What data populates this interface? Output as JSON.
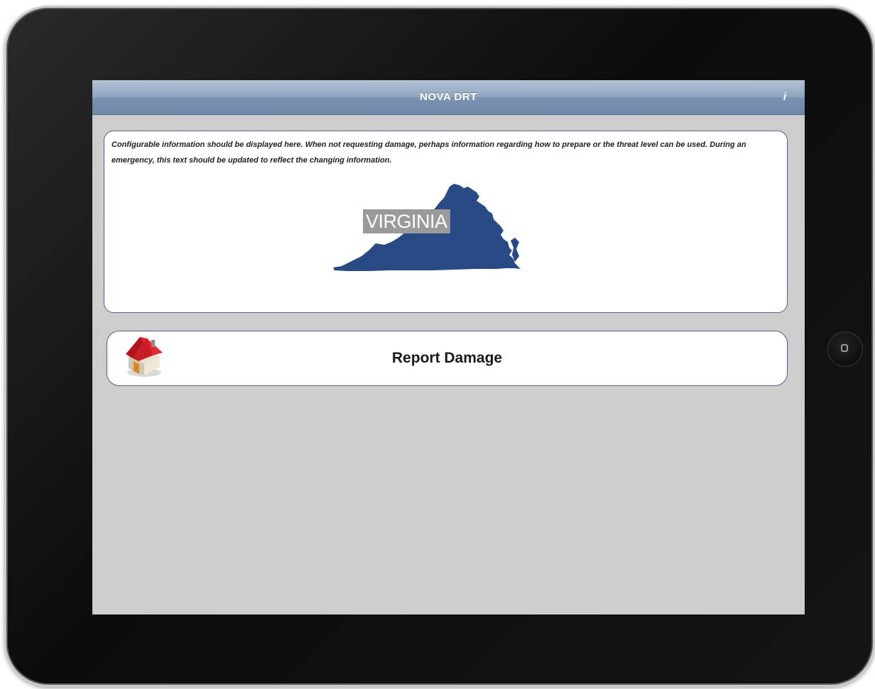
{
  "navbar": {
    "title": "NOVA DRT",
    "info_glyph": "i"
  },
  "info_panel": {
    "text": "Configurable information should be displayed here.  When not requesting damage, perhaps information regarding how to prepare or the threat level can be used.  During an emergency, this text should be updated to reflect the changing information.",
    "map_label": "VIRGINIA",
    "map_icon": "virginia-state-map",
    "map_color": "#2a4a86"
  },
  "report_button": {
    "label": "Report Damage",
    "icon": "house-icon",
    "icon_roof_color": "#d8202a"
  }
}
